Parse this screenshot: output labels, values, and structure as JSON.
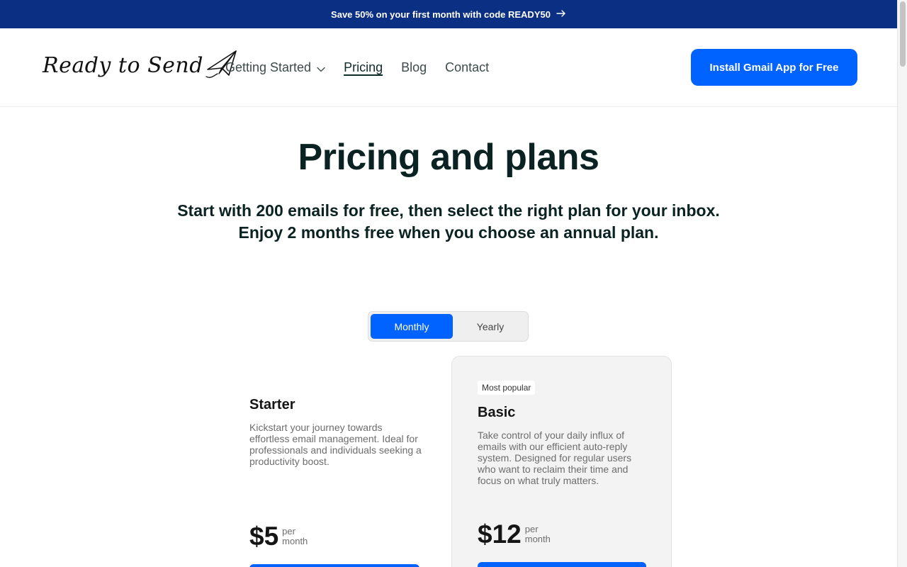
{
  "promo": {
    "text": "Save 50% on your first month with code READY50",
    "arrow_icon": "arrow-right-icon"
  },
  "header": {
    "logo_text": "Ready to Send",
    "logo_icon": "paper-plane-icon",
    "nav": [
      {
        "label": "Getting Started",
        "has_dropdown": true
      },
      {
        "label": "Pricing",
        "active": true
      },
      {
        "label": "Blog"
      },
      {
        "label": "Contact"
      }
    ],
    "cta_label": "Install Gmail App for Free"
  },
  "hero": {
    "title": "Pricing and plans",
    "subtitle_line1": "Start with 200 emails for free, then select the right plan for your inbox.",
    "subtitle_line2": "Enjoy 2 months free when you choose an annual plan."
  },
  "billing_toggle": {
    "options": [
      "Monthly",
      "Yearly"
    ],
    "selected": "Monthly"
  },
  "plans": [
    {
      "name": "Starter",
      "description": "Kickstart your journey towards effortless email management. Ideal for professionals and individuals seeking a productivity boost.",
      "price": "$5",
      "per_line1": "per",
      "per_line2": "month"
    },
    {
      "badge": "Most popular",
      "name": "Basic",
      "description": "Take control of your daily influx of emails with our efficient auto-reply system. Designed for regular users who want to reclaim their time and focus on what truly matters.",
      "price": "$12",
      "per_line1": "per",
      "per_line2": "month"
    }
  ],
  "colors": {
    "promo_bg": "#0b2f83",
    "accent": "#0062ff",
    "heading": "#0b2222"
  }
}
